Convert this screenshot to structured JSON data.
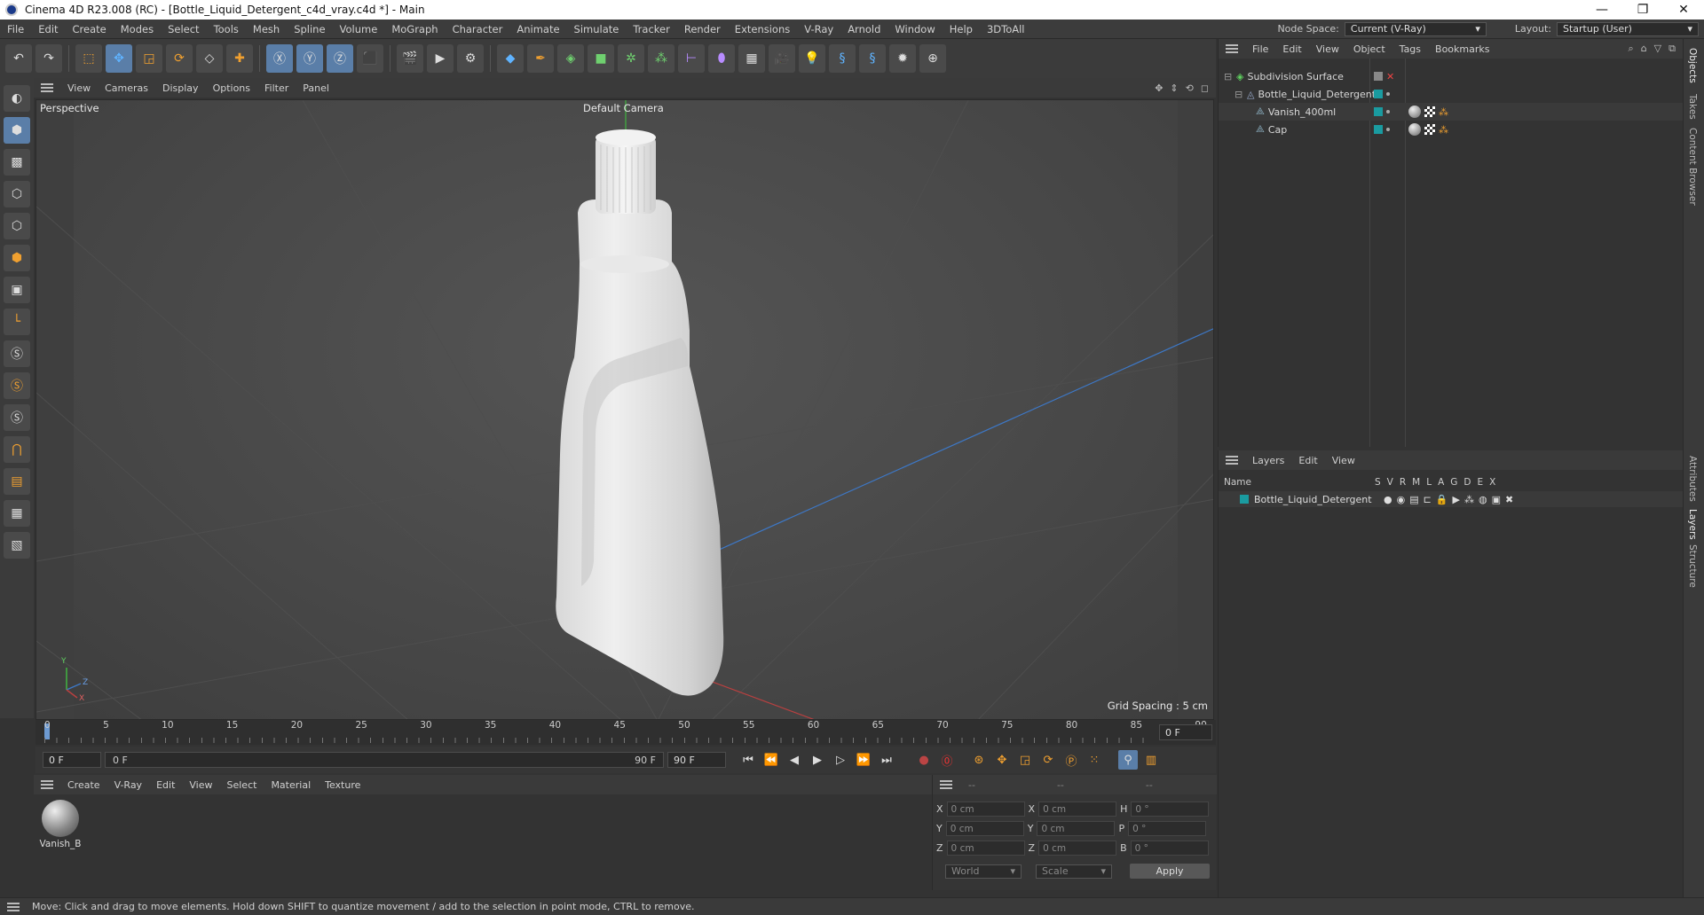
{
  "window": {
    "title": "Cinema 4D R23.008 (RC) - [Bottle_Liquid_Detergent_c4d_vray.c4d *] - Main",
    "minimize": "—",
    "maximize": "❐",
    "close": "✕"
  },
  "menu": {
    "items": [
      "File",
      "Edit",
      "Create",
      "Modes",
      "Select",
      "Tools",
      "Mesh",
      "Spline",
      "Volume",
      "MoGraph",
      "Character",
      "Animate",
      "Simulate",
      "Tracker",
      "Render",
      "Extensions",
      "V-Ray",
      "Arnold",
      "Window",
      "Help",
      "3DToAll"
    ],
    "node_space_label": "Node Space:",
    "node_space_value": "Current (V-Ray)",
    "layout_label": "Layout:",
    "layout_value": "Startup (User)"
  },
  "viewport": {
    "menu": [
      "View",
      "Cameras",
      "Display",
      "Options",
      "Filter",
      "Panel"
    ],
    "view_name": "Perspective",
    "camera": "Default Camera",
    "grid_spacing": "Grid Spacing : 5 cm",
    "axis_y": "Y",
    "axis_z": "Z",
    "axis_x": "X"
  },
  "timeline": {
    "ticks": [
      "0",
      "5",
      "10",
      "15",
      "20",
      "25",
      "30",
      "35",
      "40",
      "45",
      "50",
      "55",
      "60",
      "65",
      "70",
      "75",
      "80",
      "85",
      "90"
    ],
    "current_frame": "0 F"
  },
  "transport": {
    "start": "0 F",
    "range_start": "0 F",
    "range_end": "90 F",
    "end": "90 F"
  },
  "material_panel": {
    "menu": [
      "Create",
      "V-Ray",
      "Edit",
      "View",
      "Select",
      "Material",
      "Texture"
    ],
    "materials": [
      "Vanish_B"
    ]
  },
  "coordinates": {
    "headers": [
      "--",
      "--",
      "--"
    ],
    "rows": [
      {
        "a": "X",
        "v1": "0 cm",
        "b": "X",
        "v2": "0 cm",
        "c": "H",
        "v3": "0 °"
      },
      {
        "a": "Y",
        "v1": "0 cm",
        "b": "Y",
        "v2": "0 cm",
        "c": "P",
        "v3": "0 °"
      },
      {
        "a": "Z",
        "v1": "0 cm",
        "b": "Z",
        "v2": "0 cm",
        "c": "B",
        "v3": "0 °"
      }
    ],
    "space": "World",
    "mode": "Scale",
    "apply": "Apply"
  },
  "objects_panel": {
    "menu": [
      "File",
      "Edit",
      "View",
      "Object",
      "Tags",
      "Bookmarks"
    ],
    "items": [
      {
        "name": "Subdivision Surface",
        "indent": 0
      },
      {
        "name": "Bottle_Liquid_Detergent",
        "indent": 1
      },
      {
        "name": "Vanish_400ml",
        "indent": 2
      },
      {
        "name": "Cap",
        "indent": 2
      }
    ]
  },
  "layers_panel": {
    "menu": [
      "Layers",
      "Edit",
      "View"
    ],
    "col_name": "Name",
    "cols": [
      "S",
      "V",
      "R",
      "M",
      "L",
      "A",
      "G",
      "D",
      "E",
      "X"
    ],
    "layers": [
      "Bottle_Liquid_Detergent"
    ]
  },
  "side_tabs": [
    "Objects",
    "Takes",
    "Content Browser",
    "Attributes",
    "Layers",
    "Structure"
  ],
  "status": "Move: Click and drag to move elements. Hold down SHIFT to quantize movement / add to the selection in point mode, CTRL to remove.",
  "colors": {
    "layer_chip": "#1a9ba0",
    "accent": "#5a7ea8"
  }
}
